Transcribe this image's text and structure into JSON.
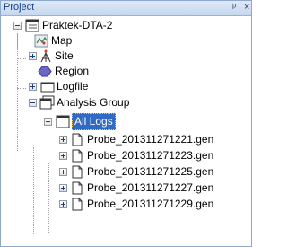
{
  "panel": {
    "title": "Project",
    "pin_glyph": "ᵖ",
    "close_glyph": "×"
  },
  "tree": {
    "root": {
      "label": "Praktek-DTA-2",
      "icon": "project-icon",
      "expanded": true
    },
    "items": [
      {
        "label": "Map",
        "icon": "map-icon"
      },
      {
        "label": "Site",
        "icon": "site-icon",
        "expandable": true
      },
      {
        "label": "Region",
        "icon": "region-icon"
      },
      {
        "label": "Logfile",
        "icon": "logfile-icon",
        "expandable": true
      },
      {
        "label": "Analysis Group",
        "icon": "analysis-group-icon",
        "expanded": true
      }
    ],
    "all_logs": {
      "label": "All Logs",
      "icon": "folder-icon",
      "selected": true
    },
    "files": [
      {
        "label": "Probe_201311271221.gen",
        "icon": "file-icon"
      },
      {
        "label": "Probe_201311271223.gen",
        "icon": "file-icon"
      },
      {
        "label": "Probe_201311271225.gen",
        "icon": "file-icon"
      },
      {
        "label": "Probe_201311271227.gen",
        "icon": "file-icon"
      },
      {
        "label": "Probe_201311271229.gen",
        "icon": "file-icon"
      }
    ]
  },
  "colors": {
    "selection": "#316ac5",
    "title_bar": "#c5d7f0",
    "title_text": "#15428b"
  }
}
